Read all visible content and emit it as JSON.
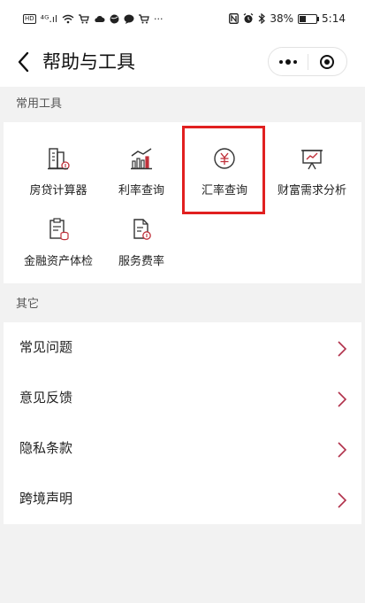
{
  "status_bar": {
    "hd": "HD",
    "signal": "⁴ᴳ.ıl",
    "more": "···",
    "battery": "38%",
    "battery_level": 0.38,
    "time": "5:14"
  },
  "nav": {
    "title": "帮助与工具"
  },
  "tools_section": {
    "header": "常用工具",
    "items": [
      {
        "label": "房贷计算器",
        "icon": "building-calculator-icon"
      },
      {
        "label": "利率查询",
        "icon": "bar-chart-icon"
      },
      {
        "label": "汇率查询",
        "icon": "yuan-circle-icon"
      },
      {
        "label": "财富需求分析",
        "icon": "presentation-chart-icon"
      },
      {
        "label": "金融资产体检",
        "icon": "clipboard-coins-icon"
      },
      {
        "label": "服务费率",
        "icon": "document-fee-icon"
      }
    ]
  },
  "other_section": {
    "header": "其它",
    "items": [
      {
        "label": "常见问题"
      },
      {
        "label": "意见反馈"
      },
      {
        "label": "隐私条款"
      },
      {
        "label": "跨境声明"
      }
    ]
  },
  "colors": {
    "highlight": "#e12020",
    "chevron": "#b0304a",
    "background": "#f2f2f2"
  }
}
